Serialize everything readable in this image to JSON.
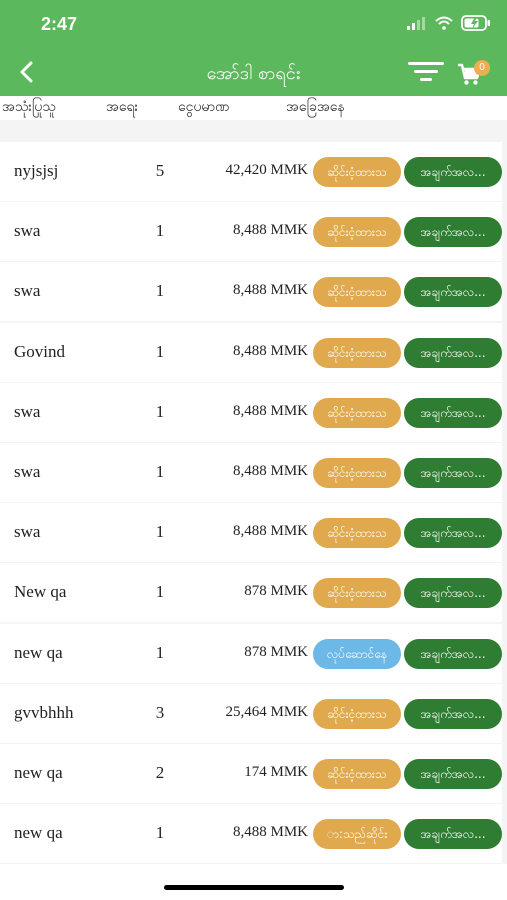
{
  "status_bar": {
    "time": "2:47"
  },
  "header": {
    "title": "အော်ဒါ စာရင်း",
    "cart_count": "0"
  },
  "columns": {
    "user": "အသုံးပြုသူ",
    "qty": "အရေး",
    "amount": "ငွေပမာဏ",
    "status": "အခြေအနေ"
  },
  "orders": [
    {
      "user": "nyjsjsj",
      "qty": "5",
      "amount": "42,420 MMK",
      "status": "ဆိုင်းငံ့ထားသ",
      "detail": "အချက်အလ..."
    },
    {
      "user": "swa",
      "qty": "1",
      "amount": "8,488 MMK",
      "status": "ဆိုင်းငံ့ထားသ",
      "detail": "အချက်အလ..."
    },
    {
      "user": "swa",
      "qty": "1",
      "amount": "8,488 MMK",
      "status": "ဆိုင်းငံ့ထားသ",
      "detail": "အချက်အလ..."
    },
    {
      "user": "Govind",
      "qty": "1",
      "amount": "8,488 MMK",
      "status": "ဆိုင်းငံ့ထားသ",
      "detail": "အချက်အလ..."
    },
    {
      "user": "swa",
      "qty": "1",
      "amount": "8,488 MMK",
      "status": "ဆိုင်းငံ့ထားသ",
      "detail": "အချက်အလ..."
    },
    {
      "user": "swa",
      "qty": "1",
      "amount": "8,488 MMK",
      "status": "ဆိုင်းငံ့ထားသ",
      "detail": "အချက်အလ..."
    },
    {
      "user": "swa",
      "qty": "1",
      "amount": "8,488 MMK",
      "status": "ဆိုင်းငံ့ထားသ",
      "detail": "အချက်အလ..."
    },
    {
      "user": "New qa",
      "qty": "1",
      "amount": "878 MMK",
      "status": "ဆိုင်းငံ့ထားသ",
      "detail": "အချက်အလ..."
    },
    {
      "user": "new qa",
      "qty": "1",
      "amount": "878 MMK",
      "status": "လုပ်ဆောင်နေ",
      "detail": "အချက်အလ..."
    },
    {
      "user": "gvvbhhh",
      "qty": "3",
      "amount": "25,464 MMK",
      "status": "ဆိုင်းငံ့ထားသ",
      "detail": "အချက်အလ..."
    },
    {
      "user": "new qa",
      "qty": "2",
      "amount": "174 MMK",
      "status": "ဆိုင်းငံ့ထားသ",
      "detail": "အချက်အလ..."
    },
    {
      "user": "new qa",
      "qty": "1",
      "amount": "8,488 MMK",
      "status": "ာ:သည်ဆိုင်း",
      "detail": "အချက်အလ..."
    }
  ],
  "colors": {
    "primary": "#5cb85c",
    "pending": "#e0a94e",
    "processing": "#6cb8e6",
    "detail_button": "#2e7d32"
  },
  "icons": [
    "back-arrow-icon",
    "filter-icon",
    "cart-icon",
    "signal-icon",
    "wifi-icon",
    "battery-icon"
  ]
}
